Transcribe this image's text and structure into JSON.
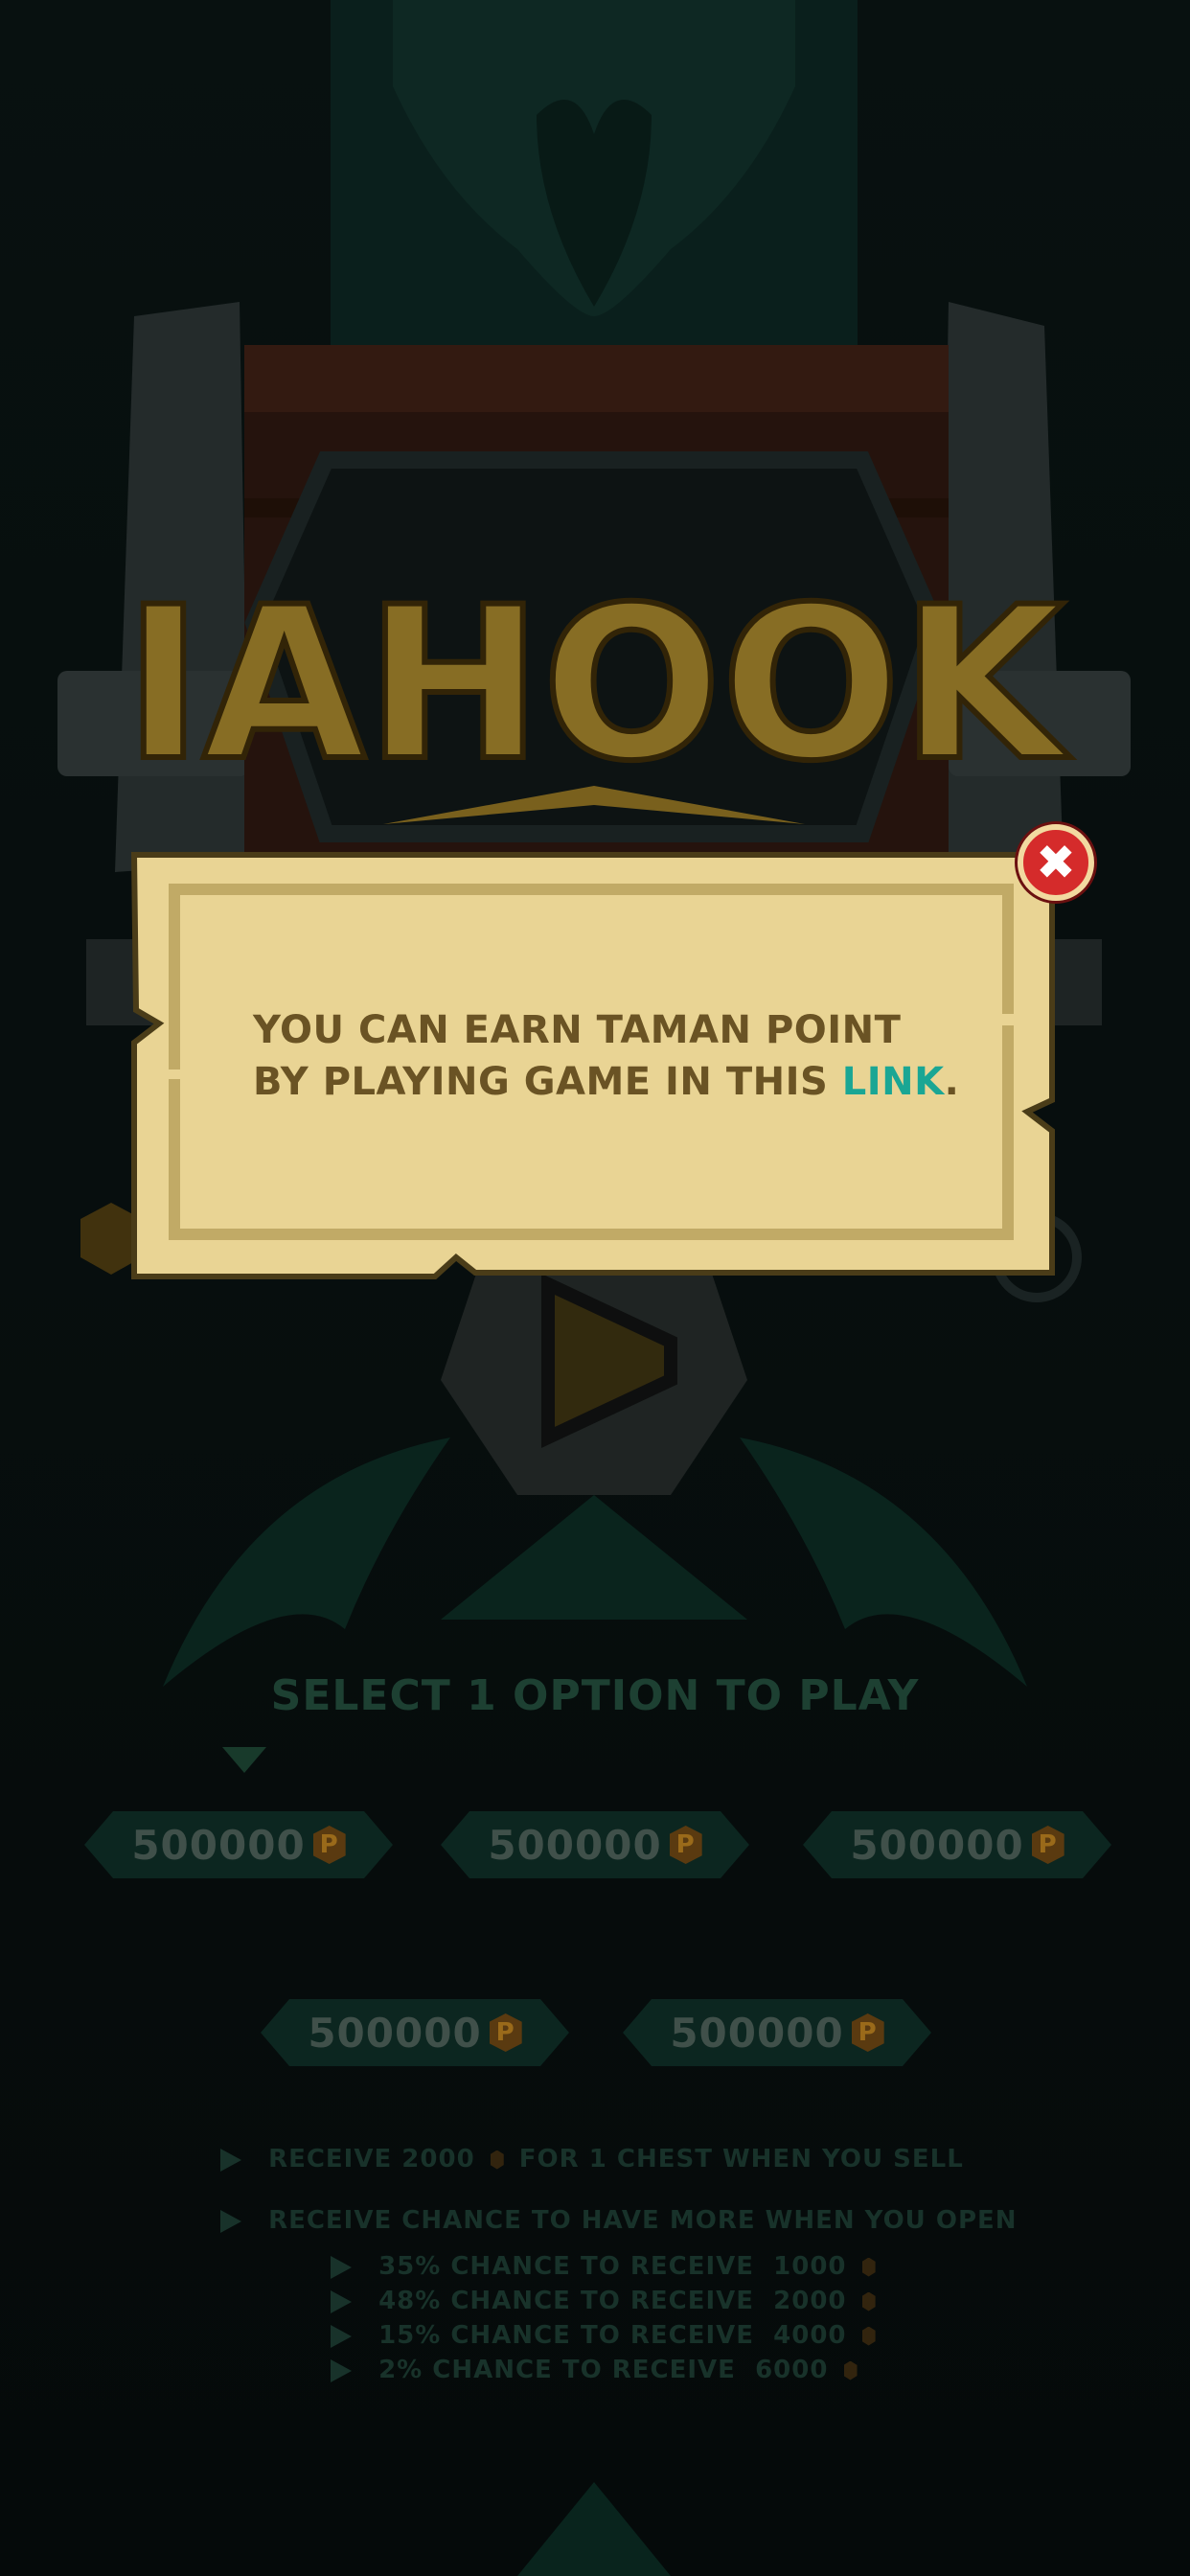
{
  "game": {
    "logo_text": "IAHOOK"
  },
  "popup": {
    "line1": "YOU CAN EARN TAMAN POINT",
    "line2_prefix": "BY PLAYING GAME IN THIS ",
    "link_label": "LINK",
    "line2_suffix": ".",
    "close_icon": "close-x-icon"
  },
  "select": {
    "title": "SELECT 1 OPTION TO PLAY",
    "options": [
      {
        "value": "500000"
      },
      {
        "value": "500000"
      },
      {
        "value": "500000"
      },
      {
        "value": "500000"
      },
      {
        "value": "500000"
      }
    ]
  },
  "info": {
    "sell_line": "RECEIVE 2000",
    "sell_line_suffix": "FOR 1 CHEST WHEN YOU SELL",
    "open_line": "RECEIVE CHANCE TO HAVE MORE WHEN YOU OPEN",
    "chances": [
      {
        "label": "35% CHANCE TO RECEIVE",
        "amount": "1000"
      },
      {
        "label": "48% CHANCE TO RECEIVE",
        "amount": "2000"
      },
      {
        "label": "15% CHANCE TO RECEIVE",
        "amount": "4000"
      },
      {
        "label": "2% CHANCE TO RECEIVE",
        "amount": "6000"
      }
    ]
  },
  "colors": {
    "background": "#070d0d",
    "popup_paper": "#e9d494",
    "popup_border": "#c1aa66",
    "popup_text": "#6a5324",
    "link": "#1aa694",
    "close_button": "#d52b2b",
    "logo_gold": "#a88b2e"
  }
}
